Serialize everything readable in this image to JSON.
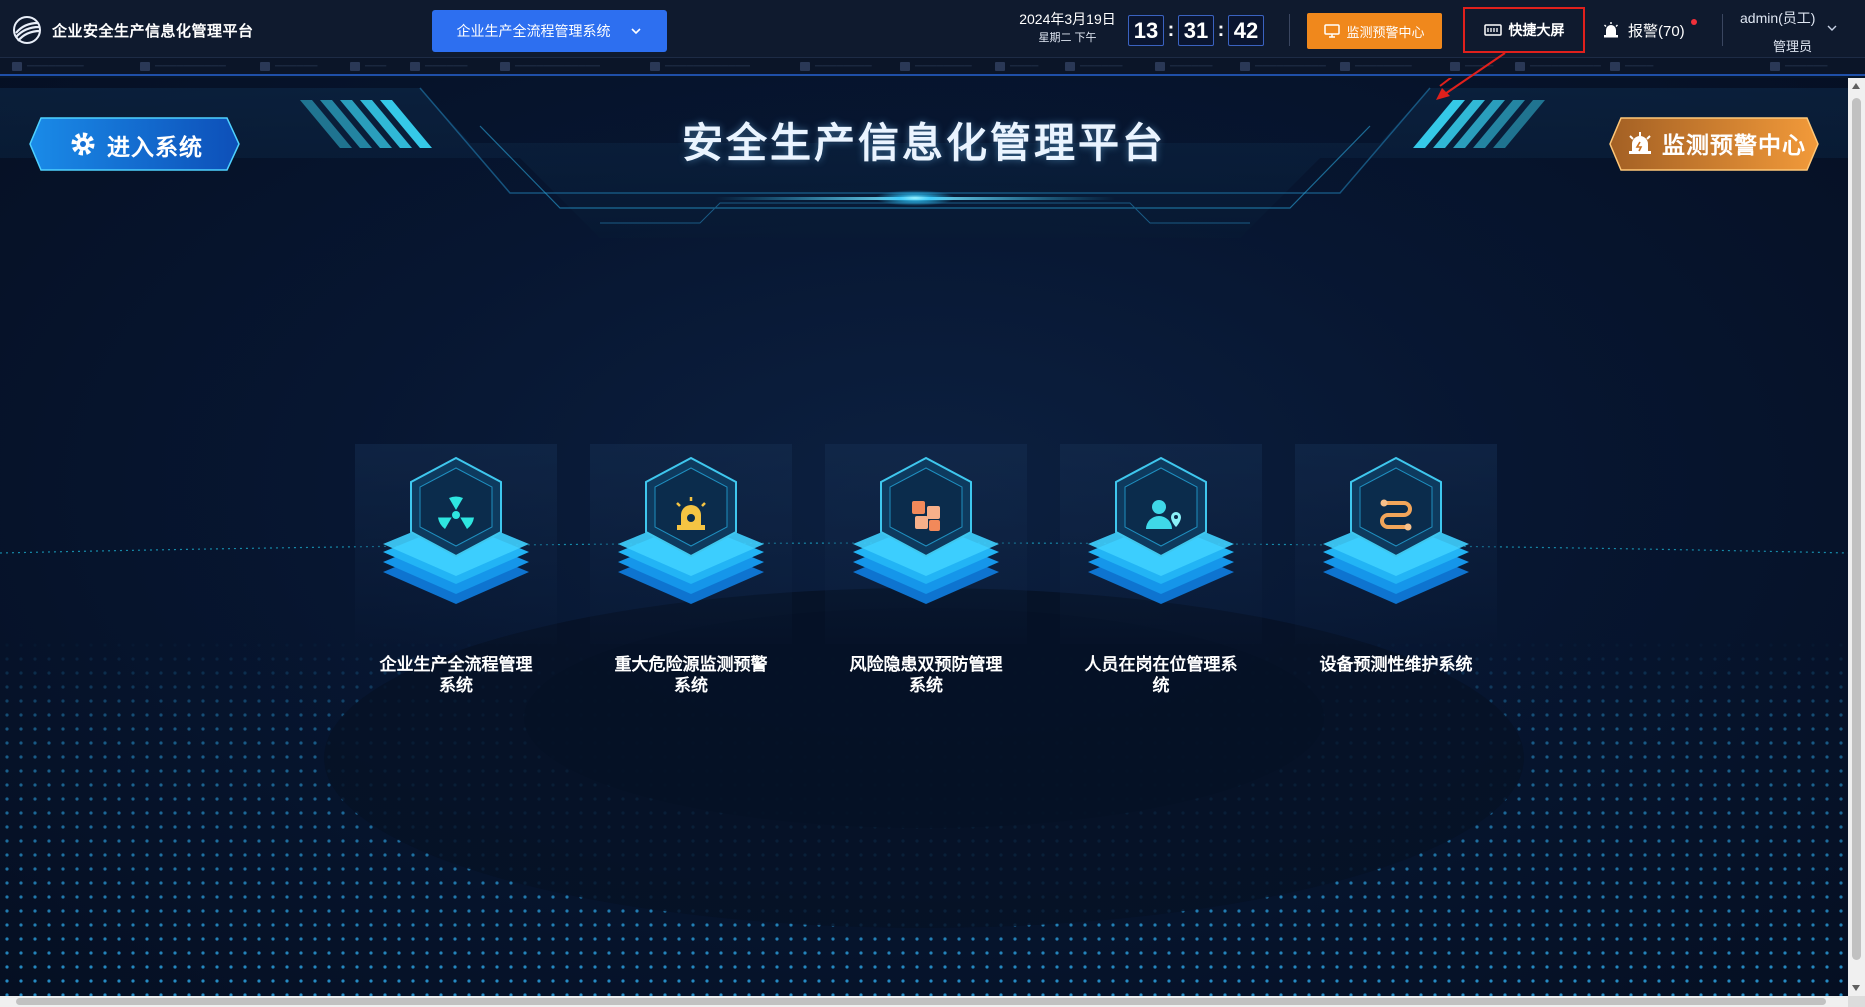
{
  "header": {
    "app_title": "企业安全生产信息化管理平台",
    "system_select_value": "企业生产全流程管理系统",
    "date": "2024年3月19日",
    "weekday": "星期二",
    "ampm": "下午",
    "clock": {
      "hours": "13",
      "minutes": "31",
      "seconds": "42"
    },
    "monitor_button": "监测预警中心",
    "quick_screen_button": "快捷大屏",
    "alarm_label": "报警(70)",
    "user_name": "admin(员工)",
    "user_role": "管理员"
  },
  "stage": {
    "title": "安全生产信息化管理平台",
    "enter_button": "进入系统",
    "monitor_button": "监测预警中心"
  },
  "cards": [
    {
      "label_line1": "企业生产全流程管理",
      "label_line2": "系统",
      "icon": "radiation-icon",
      "icon_color": "#2ee6e0"
    },
    {
      "label_line1": "重大危险源监测预警",
      "label_line2": "系统",
      "icon": "alarm-light-icon",
      "icon_color": "#f5c443"
    },
    {
      "label_line1": "风险隐患双预防管理",
      "label_line2": "系统",
      "icon": "blocks-icon",
      "icon_color": "#f2895a"
    },
    {
      "label_line1": "人员在岗在位管理系",
      "label_line2": "统",
      "icon": "person-location-icon",
      "icon_color": "#3fd8e8"
    },
    {
      "label_line1": "设备预测性维护系统",
      "label_line2": "",
      "icon": "route-icon",
      "icon_color": "#f2a55a"
    }
  ],
  "colors": {
    "accent_blue": "#2d6ff0",
    "accent_orange": "#f0881c",
    "highlight_red": "#e0201c",
    "background": "#07162b"
  }
}
